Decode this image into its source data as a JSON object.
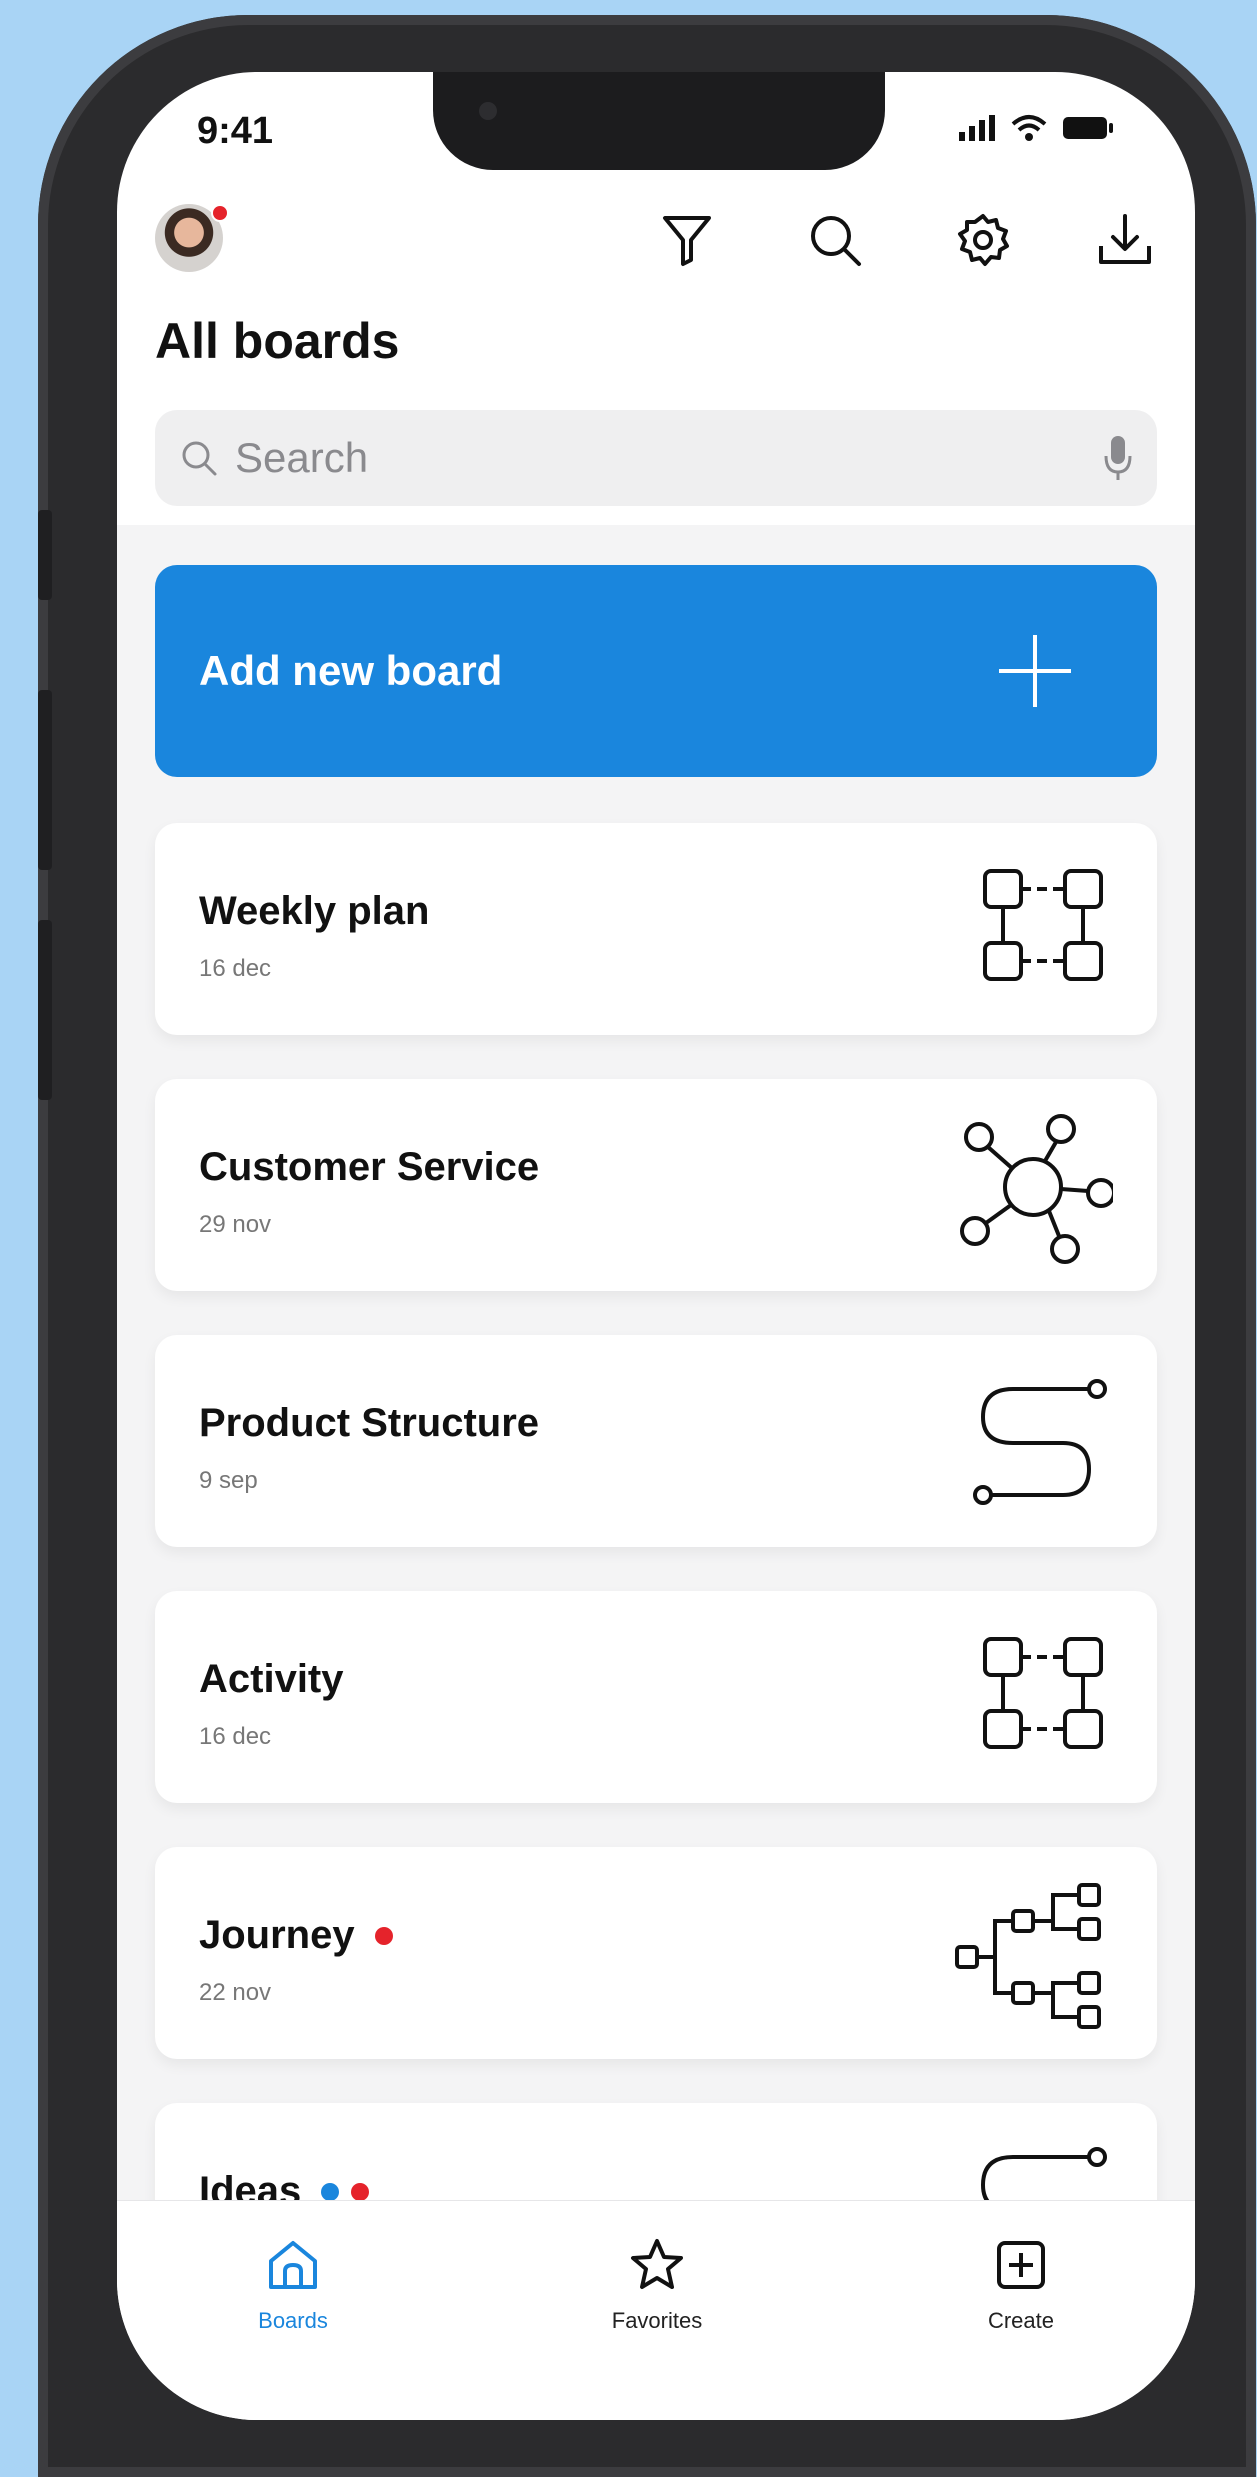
{
  "status": {
    "time": "9:41"
  },
  "header": {
    "title": "All boards"
  },
  "search": {
    "placeholder": "Search"
  },
  "add_board": {
    "label": "Add new board"
  },
  "boards": [
    {
      "name": "Weekly plan",
      "date": "16 dec",
      "icon": "grid-flow-icon",
      "dots": []
    },
    {
      "name": "Customer Service",
      "date": "29 nov",
      "icon": "hub-network-icon",
      "dots": []
    },
    {
      "name": "Product Structure",
      "date": "9 sep",
      "icon": "s-path-icon",
      "dots": []
    },
    {
      "name": "Activity",
      "date": "16 dec",
      "icon": "grid-flow-icon",
      "dots": []
    },
    {
      "name": "Journey",
      "date": "22 nov",
      "icon": "tree-hierarchy-icon",
      "dots": [
        "#e5232b"
      ]
    },
    {
      "name": "Ideas",
      "date": "",
      "icon": "curve-path-icon",
      "dots": [
        "#1a86dd",
        "#e5232b"
      ]
    }
  ],
  "tabs": [
    {
      "label": "Boards",
      "icon": "home-icon",
      "active": true
    },
    {
      "label": "Favorites",
      "icon": "star-icon",
      "active": false
    },
    {
      "label": "Create",
      "icon": "plus-square-icon",
      "active": false
    }
  ],
  "colors": {
    "accent": "#1a86dd",
    "alert": "#e5232b",
    "background": "#a9d4f5"
  }
}
